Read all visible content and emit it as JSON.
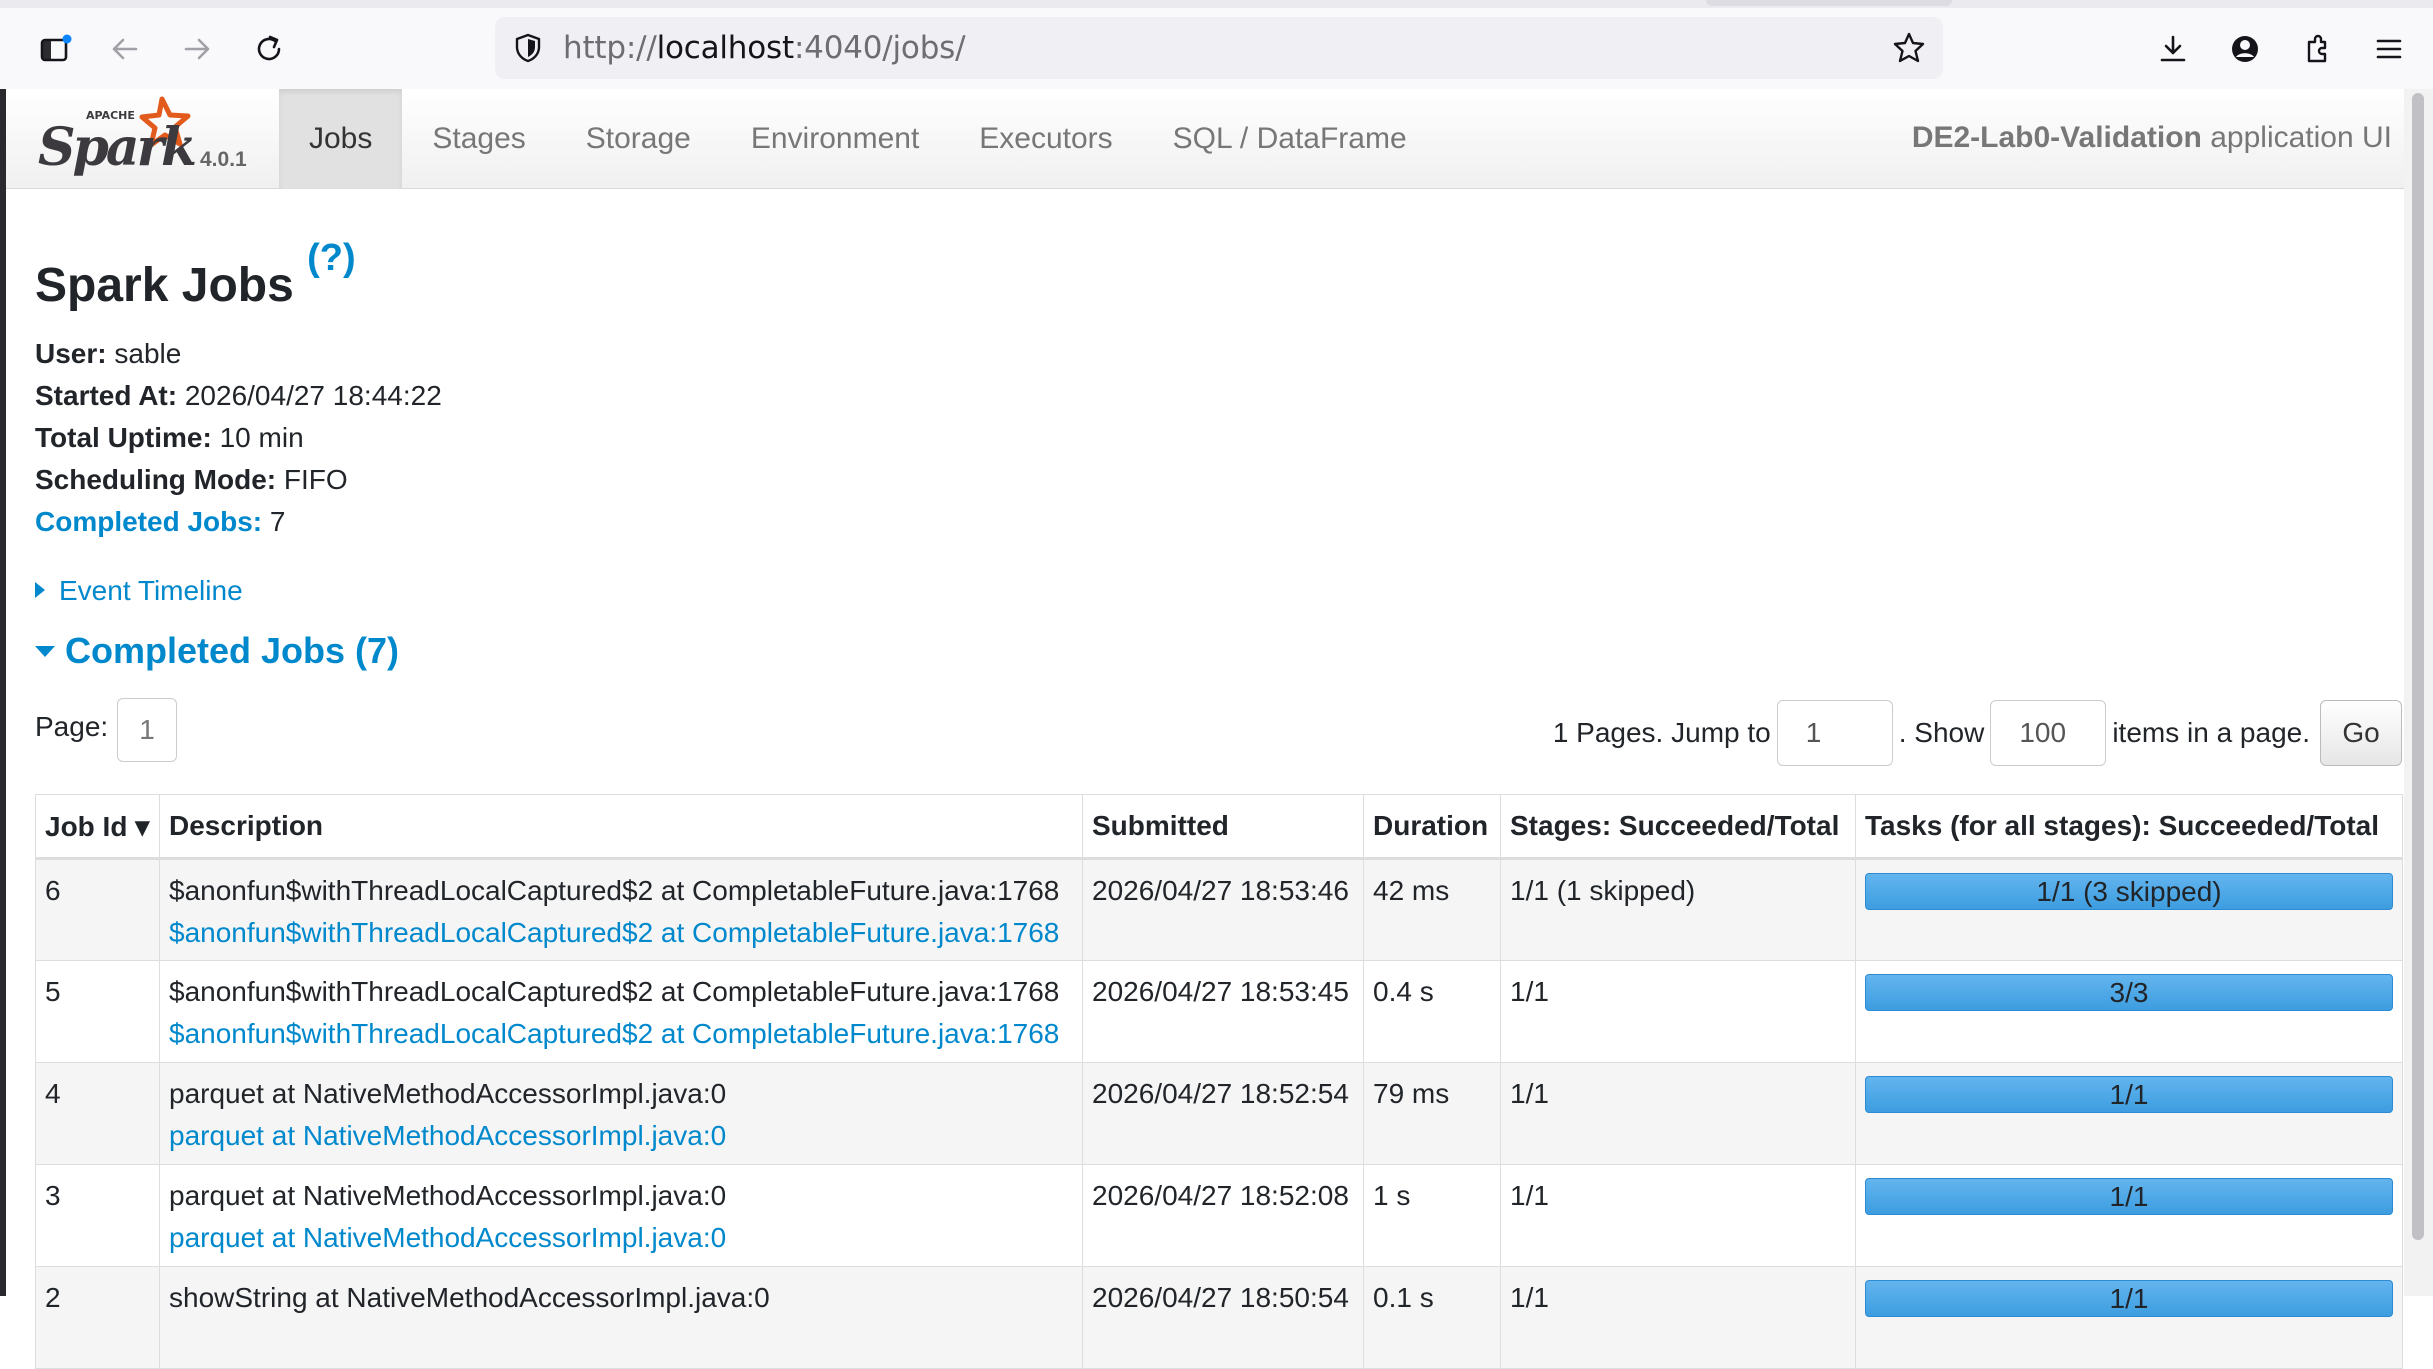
{
  "browser": {
    "url_scheme": "http://",
    "url_host": "localhost",
    "url_rest": ":4040/jobs/"
  },
  "spark": {
    "version": "4.0.1",
    "tabs": [
      {
        "label": "Jobs",
        "active": true
      },
      {
        "label": "Stages",
        "active": false
      },
      {
        "label": "Storage",
        "active": false
      },
      {
        "label": "Environment",
        "active": false
      },
      {
        "label": "Executors",
        "active": false
      },
      {
        "label": "SQL / DataFrame",
        "active": false
      }
    ],
    "app_name": "DE2-Lab0-Validation",
    "app_suffix": "application UI"
  },
  "page": {
    "title": "Spark Jobs",
    "help": "(?)",
    "summary": {
      "user_label": "User:",
      "user": "sable",
      "started_label": "Started At:",
      "started": "2026/04/27 18:44:22",
      "uptime_label": "Total Uptime:",
      "uptime": "10 min",
      "mode_label": "Scheduling Mode:",
      "mode": "FIFO",
      "completed_label": "Completed Jobs:",
      "completed": "7"
    },
    "event_timeline": "Event Timeline",
    "section_title": "Completed Jobs (7)"
  },
  "pager": {
    "page_label": "Page:",
    "current_page": "1",
    "pages_text": "1 Pages. Jump to",
    "jump_value": "1",
    "show_text": ". Show",
    "show_value": "100",
    "items_text": "items in a page.",
    "go_label": "Go"
  },
  "table": {
    "headers": [
      "Job Id ▾",
      "Description",
      "Submitted",
      "Duration",
      "Stages: Succeeded/Total",
      "Tasks (for all stages): Succeeded/Total"
    ],
    "rows": [
      {
        "id": "6",
        "desc": "$anonfun$withThreadLocalCaptured$2 at CompletableFuture.java:1768",
        "link": "$anonfun$withThreadLocalCaptured$2 at CompletableFuture.java:1768",
        "submitted": "2026/04/27 18:53:46",
        "duration": "42 ms",
        "stages": "1/1 (1 skipped)",
        "tasks": "1/1 (3 skipped)",
        "progress": 1.0
      },
      {
        "id": "5",
        "desc": "$anonfun$withThreadLocalCaptured$2 at CompletableFuture.java:1768",
        "link": "$anonfun$withThreadLocalCaptured$2 at CompletableFuture.java:1768",
        "submitted": "2026/04/27 18:53:45",
        "duration": "0.4 s",
        "stages": "1/1",
        "tasks": "3/3",
        "progress": 1.0
      },
      {
        "id": "4",
        "desc": "parquet at NativeMethodAccessorImpl.java:0",
        "link": "parquet at NativeMethodAccessorImpl.java:0",
        "submitted": "2026/04/27 18:52:54",
        "duration": "79 ms",
        "stages": "1/1",
        "tasks": "1/1",
        "progress": 1.0
      },
      {
        "id": "3",
        "desc": "parquet at NativeMethodAccessorImpl.java:0",
        "link": "parquet at NativeMethodAccessorImpl.java:0",
        "submitted": "2026/04/27 18:52:08",
        "duration": "1 s",
        "stages": "1/1",
        "tasks": "1/1",
        "progress": 1.0
      },
      {
        "id": "2",
        "desc": "showString at NativeMethodAccessorImpl.java:0",
        "link": "",
        "submitted": "2026/04/27 18:50:54",
        "duration": "0.1 s",
        "stages": "1/1",
        "tasks": "1/1",
        "progress": 1.0
      }
    ]
  }
}
